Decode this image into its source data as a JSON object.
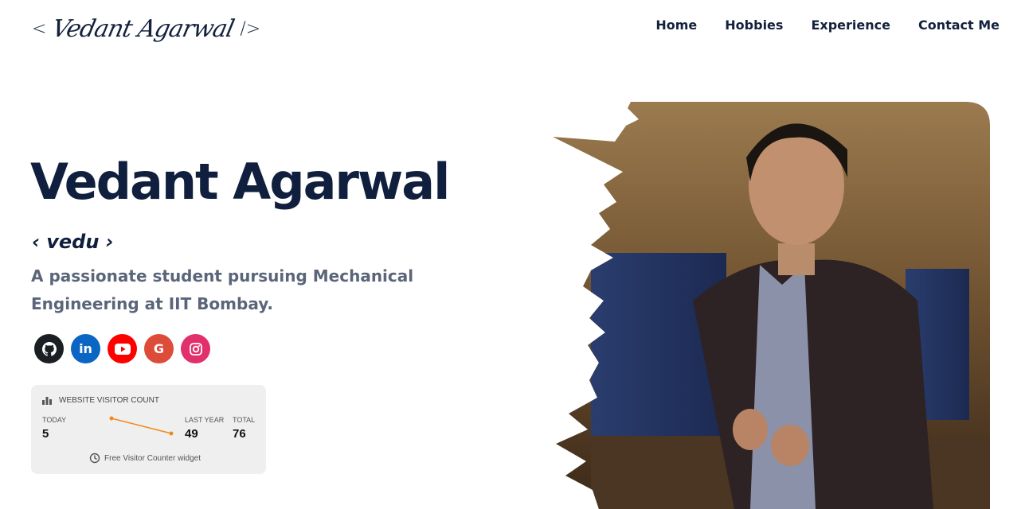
{
  "header": {
    "logo_open": "<",
    "logo_signature": "Vedant Agarwal",
    "logo_close": "/>",
    "nav": [
      "Home",
      "Hobbies",
      "Experience",
      "Contact Me"
    ]
  },
  "hero": {
    "name": "Vedant Agarwal",
    "nickname": "‹ vedu ›",
    "tagline": "A passionate student pursuing Mechanical Engineering at IIT Bombay."
  },
  "socials": [
    {
      "icon": "github-icon",
      "glyph": "",
      "color": "#1b1f23"
    },
    {
      "icon": "linkedin-icon",
      "glyph": "in",
      "color": "#0a66c2"
    },
    {
      "icon": "youtube-icon",
      "glyph": "▶",
      "color": "#ff0000"
    },
    {
      "icon": "google-icon",
      "glyph": "G",
      "color": "#dd4b39"
    },
    {
      "icon": "instagram-icon",
      "glyph": "",
      "color": "#e1306c"
    }
  ],
  "visitor_widget": {
    "title": "WEBSITE VISITOR COUNT",
    "today_label": "TODAY",
    "today_value": "5",
    "last_year_label": "LAST YEAR",
    "last_year_value": "49",
    "total_label": "TOTAL",
    "total_value": "76",
    "footer": "Free Visitor Counter widget",
    "line_color": "#f08a1c"
  },
  "colors": {
    "heading": "#0f1f3d",
    "tagline": "#5b6579",
    "widget_bg": "#efefef"
  }
}
